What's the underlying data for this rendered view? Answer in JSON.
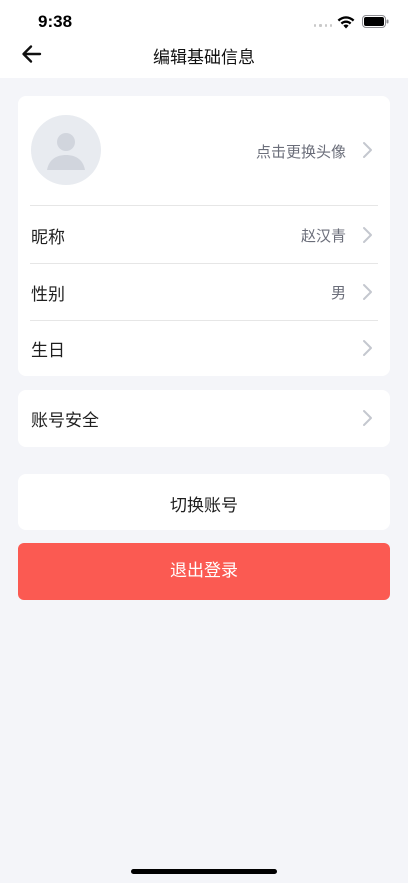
{
  "status_bar": {
    "time": "9:38"
  },
  "nav": {
    "title": "编辑基础信息",
    "back_icon": "arrow-left-icon"
  },
  "profile": {
    "avatar_icon": "user-avatar-placeholder-icon",
    "avatar_hint": "点击更换头像",
    "rows": [
      {
        "label": "昵称",
        "value": "赵汉青"
      },
      {
        "label": "性别",
        "value": "男"
      },
      {
        "label": "生日",
        "value": ""
      }
    ]
  },
  "security": {
    "label": "账号安全"
  },
  "actions": {
    "switch_account": "切换账号",
    "logout": "退出登录"
  },
  "colors": {
    "background": "#f4f5f9",
    "card": "#ffffff",
    "logout_button": "#fb5a52",
    "secondary_text": "#6b6e7a",
    "chevron": "#c4c7cf"
  }
}
